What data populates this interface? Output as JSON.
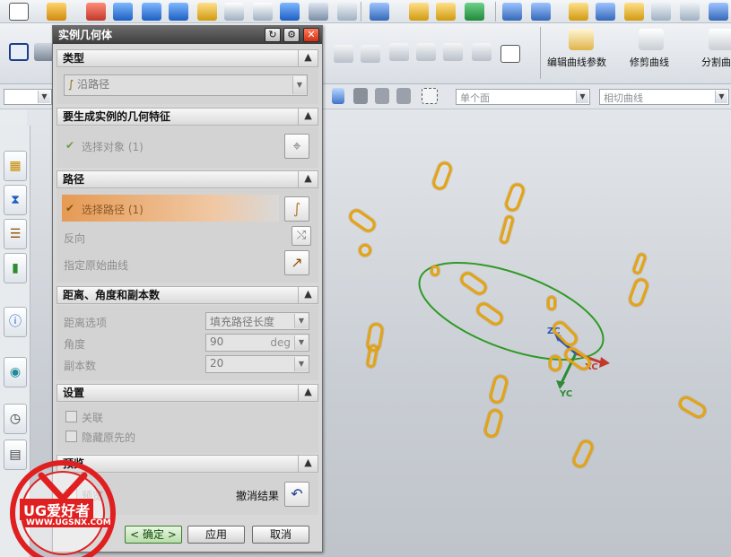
{
  "dialog": {
    "title": "实例几何体",
    "sections": {
      "type": "类型",
      "features": "要生成实例的几何特征",
      "path": "路径",
      "distance": "距离、角度和副本数",
      "settings": "设置",
      "preview": "预览"
    },
    "type_value": "沿路径",
    "select_object_label": "选择对象 (1)",
    "select_path_label": "选择路径 (1)",
    "reverse_label": "反向",
    "original_curve_label": "指定原始曲线",
    "distance_option_label": "距离选项",
    "distance_option_value": "填充路径长度",
    "angle_label": "角度",
    "angle_value": "90",
    "angle_unit": "deg",
    "copies_label": "副本数",
    "copies_value": "20",
    "associative_label": "关联",
    "hide_original_label": "隐藏原先的",
    "preview_label": "预览",
    "undo_result_label": "撤消结果",
    "ok_label": "< 确定 >",
    "apply_label": "应用",
    "cancel_label": "取消"
  },
  "toolbar": {
    "edit_curve_params": "编辑曲线参数",
    "trim_curve": "修剪曲线",
    "split_curve": "分割曲"
  },
  "filter": {
    "face_filter": "单个面",
    "curve_filter": "相切曲线"
  },
  "graphics": {
    "axis_x": "XC",
    "axis_y": "YC",
    "axis_z": "ZC",
    "accent_color": "#e2a414",
    "path_color": "#2f9a25"
  },
  "watermark": {
    "brand": "UG爱好者",
    "url": "WWW.UGSNX.COM"
  }
}
